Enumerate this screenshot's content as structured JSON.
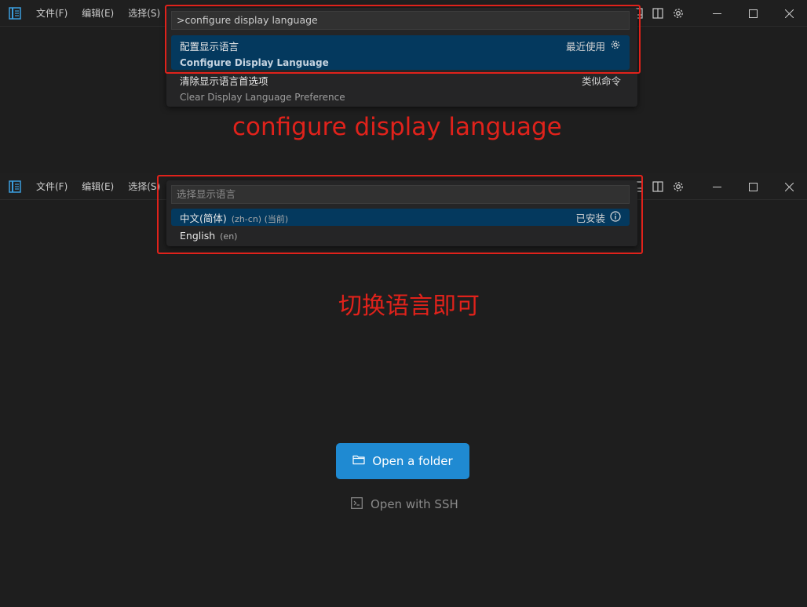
{
  "titlebar": {
    "menus": [
      "文件(F)",
      "编辑(E)",
      "选择(S)"
    ]
  },
  "panel1": {
    "input_value": ">configure display language",
    "items": [
      {
        "label": "配置显示语言",
        "sublabel": "Configure Display Language",
        "right_text": "最近使用",
        "right_icon": "gear-icon"
      },
      {
        "label": "清除显示语言首选项",
        "sublabel": "Clear Display Language Preference",
        "right_text": "类似命令"
      }
    ]
  },
  "panel2": {
    "input_placeholder": "选择显示语言",
    "items": [
      {
        "label": "中文(简体)",
        "desc": "(zh-cn) (当前)",
        "right_text": "已安装",
        "right_icon": "info-icon"
      },
      {
        "label": "English",
        "desc": "(en)"
      }
    ]
  },
  "annotations": {
    "first": "configure display language",
    "second": "切换语言即可"
  },
  "welcome": {
    "open_folder": "Open a folder",
    "open_ssh": "Open with SSH"
  },
  "colors": {
    "accent_red": "#e0221b",
    "primary_button": "#1f8ad2",
    "selected_row": "#04395e",
    "background": "#1e1e1e"
  }
}
